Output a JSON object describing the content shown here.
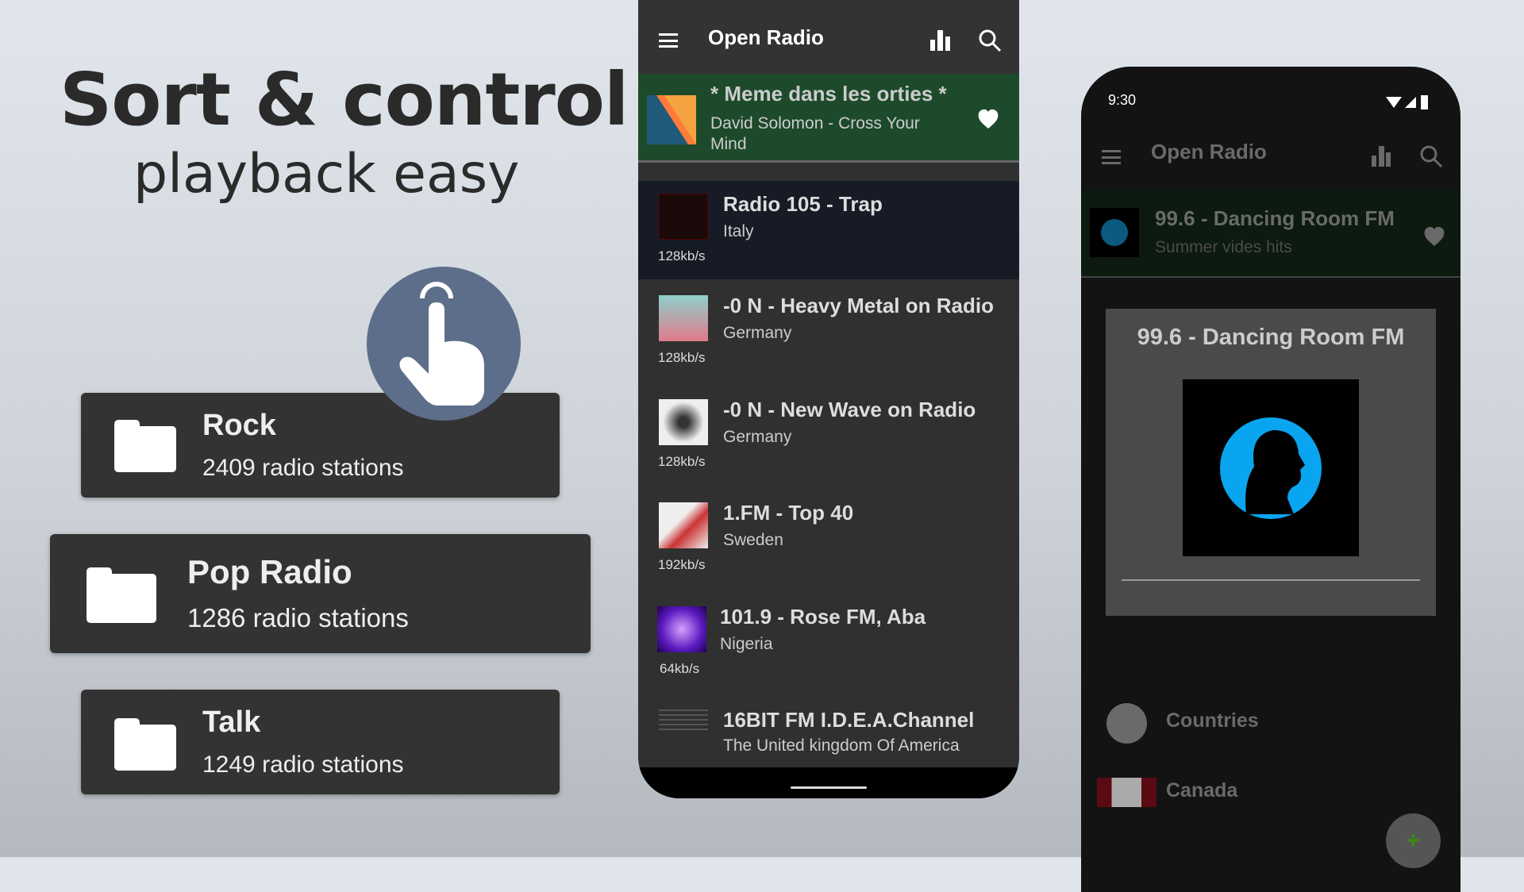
{
  "headline": {
    "title": "Sort & control",
    "subtitle": "playback easy"
  },
  "categories": [
    {
      "name": "Rock",
      "count": "2409 radio stations"
    },
    {
      "name": "Pop Radio",
      "count": "1286 radio stations"
    },
    {
      "name": "Talk",
      "count": "1249 radio stations"
    }
  ],
  "phone_main": {
    "app_title": "Open Radio",
    "now_playing": {
      "title": "* Meme dans les orties *",
      "subtitle": "David Solomon - Cross Your Mind",
      "favorite": true
    },
    "stations": [
      {
        "name": "Radio 105 - Trap",
        "country": "Italy",
        "bitrate": "128kb/s"
      },
      {
        "name": "-0 N - Heavy Metal on Radio",
        "country": "Germany",
        "bitrate": "128kb/s"
      },
      {
        "name": "-0 N - New Wave on Radio",
        "country": "Germany",
        "bitrate": "128kb/s"
      },
      {
        "name": "1.FM - Top 40",
        "country": "Sweden",
        "bitrate": "192kb/s"
      },
      {
        "name": "101.9 - Rose FM, Aba",
        "country": "Nigeria",
        "bitrate": "64kb/s"
      },
      {
        "name": "16BIT FM I.D.E.A.Channel",
        "country": "The United kingdom Of America",
        "bitrate": ""
      }
    ]
  },
  "phone_side": {
    "time": "9:30",
    "app_title": "Open Radio",
    "now_playing": {
      "title": "99.6 - Dancing Room FM",
      "subtitle": "Summer vides hits"
    },
    "dialog_title": "99.6 - Dancing Room FM",
    "menu": [
      {
        "label": "Countries",
        "icon": "globe-icon"
      },
      {
        "label": "Canada",
        "icon": "canada-flag-icon"
      }
    ]
  },
  "colors": {
    "now_playing_bg": "#1d4a2b",
    "card_bg": "#333333",
    "hand_circle": "#5d6e8a",
    "accent_blue": "#0aa5f0"
  }
}
